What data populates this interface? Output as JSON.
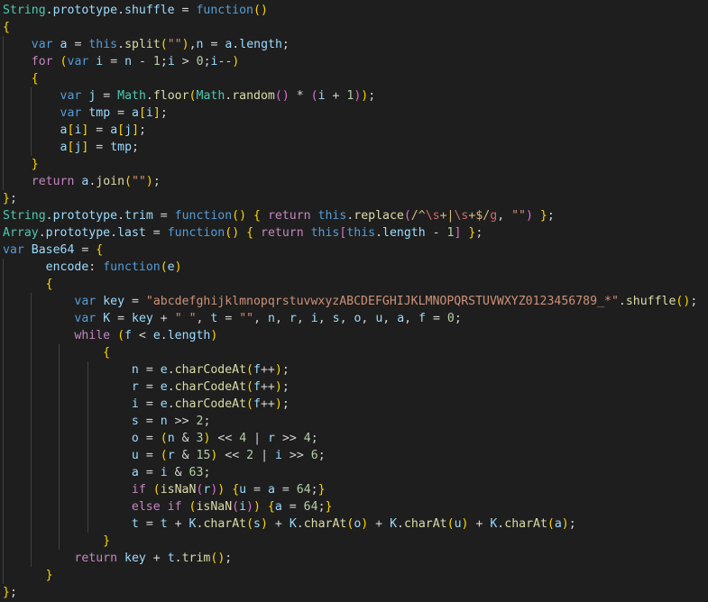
{
  "editor": {
    "language": "javascript",
    "theme": "dark-plus",
    "background_color": "#1e1e1e",
    "foreground_color": "#d4d4d4",
    "indent_guide_color": "#404040",
    "font_size_px": 13,
    "line_height_px": 19,
    "total_lines": 35,
    "tab_size": 4
  },
  "colors": {
    "keyword": "#569cd6",
    "control_keyword": "#c586c0",
    "class_name": "#4ec9b0",
    "function_name": "#dcdcaa",
    "variable": "#9cdcfe",
    "string": "#ce9178",
    "number": "#b5cea8",
    "operator": "#d4d4d4",
    "bracket_level_1": "#ffd700",
    "bracket_level_2": "#da70d6",
    "bracket_level_3": "#179fff",
    "regex": "#d16969",
    "regex_anchor": "#d7ba7d"
  },
  "code": {
    "lines": [
      "String.prototype.shuffle = function()",
      "{",
      "    var a = this.split(\"\"),n = a.length;",
      "    for (var i = n - 1;i > 0;i--)",
      "    {",
      "        var j = Math.floor(Math.random() * (i + 1));",
      "        var tmp = a[i];",
      "        a[i] = a[j];",
      "        a[j] = tmp;",
      "    }",
      "    return a.join(\"\");",
      "};",
      "String.prototype.trim = function() { return this.replace(/^\\s+|\\s+$/g, \"\") };",
      "Array.prototype.last = function() { return this[this.length - 1] };",
      "var Base64 = {",
      "      encode: function(e)",
      "      {",
      "          var key = \"abcdefghijklmnopqrstuvwxyzABCDEFGHIJKLMNOPQRSTUVWXYZ0123456789_*\".shuffle();",
      "          var K = key + \" \", t = \"\", n, r, i, s, o, u, a, f = 0;",
      "          while (f < e.length)",
      "              {",
      "                  n = e.charCodeAt(f++);",
      "                  r = e.charCodeAt(f++);",
      "                  i = e.charCodeAt(f++);",
      "                  s = n >> 2;",
      "                  o = (n & 3) << 4 | r >> 4;",
      "                  u = (r & 15) << 2 | i >> 6;",
      "                  a = i & 63;",
      "                  if (isNaN(r)) {u = a = 64;}",
      "                  else if (isNaN(i)) {a = 64;}",
      "                  t = t + K.charAt(s) + K.charAt(o) + K.charAt(u) + K.charAt(a);",
      "              }",
      "          return key + t.trim();",
      "      }",
      "};"
    ],
    "base64_alphabet": "abcdefghijklmnopqrstuvwxyzABCDEFGHIJKLMNOPQRSTUVWXYZ0123456789_*",
    "regex_literal": "/^\\s+|\\s+$/g",
    "identifiers": [
      "String",
      "prototype",
      "shuffle",
      "Array",
      "last",
      "trim",
      "Base64",
      "encode",
      "Math",
      "floor",
      "random",
      "split",
      "join",
      "replace",
      "charCodeAt",
      "charAt",
      "isNaN",
      "length"
    ],
    "numbers": [
      "1",
      "0",
      "2",
      "3",
      "4",
      "15",
      "6",
      "63",
      "64"
    ]
  }
}
